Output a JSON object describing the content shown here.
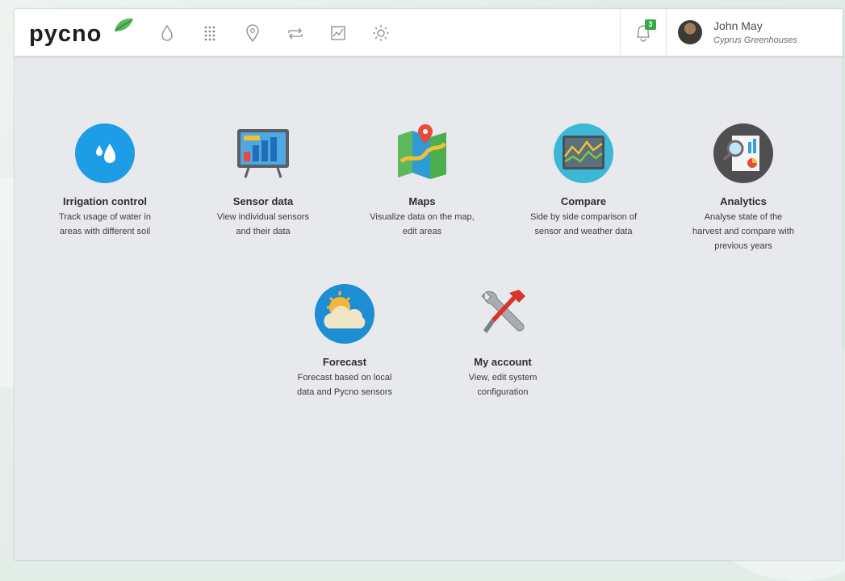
{
  "brand": {
    "logo_text": "pycno"
  },
  "nav": [
    {
      "name": "irrigation",
      "icon": "water-drop-icon"
    },
    {
      "name": "sensors",
      "icon": "grid-dots-icon"
    },
    {
      "name": "maps",
      "icon": "location-pin-icon"
    },
    {
      "name": "compare",
      "icon": "compare-arrows-icon"
    },
    {
      "name": "analytics",
      "icon": "line-chart-icon"
    },
    {
      "name": "forecast",
      "icon": "sun-icon"
    }
  ],
  "notifications": {
    "count": "3",
    "icon": "bell-icon"
  },
  "user": {
    "name": "John May",
    "organization": "Cyprus Greenhouses"
  },
  "tiles": [
    {
      "title": "Irrigation control",
      "desc_1": "Track usage of water in",
      "desc_2": "areas with different soil",
      "desc_3": "",
      "icon": "irrigation-drops-icon"
    },
    {
      "title": "Sensor data",
      "desc_1": "View individual sensors",
      "desc_2": "and their data",
      "desc_3": "",
      "icon": "sensor-monitor-icon"
    },
    {
      "title": "Maps",
      "desc_1": "Visualize data on the map,",
      "desc_2": "edit areas",
      "desc_3": "",
      "icon": "folded-map-icon"
    },
    {
      "title": "Compare",
      "desc_1": "Side by side comparison of",
      "desc_2": "sensor and weather data",
      "desc_3": "",
      "icon": "compare-chart-icon"
    },
    {
      "title": "Analytics",
      "desc_1": "Analyse state of the",
      "desc_2": "harvest and compare with",
      "desc_3": "previous years",
      "icon": "analytics-magnifier-icon"
    },
    {
      "title": "Forecast",
      "desc_1": "Forecast based on local",
      "desc_2": "data and Pycno sensors",
      "desc_3": "",
      "icon": "sun-cloud-icon"
    },
    {
      "title": "My account",
      "desc_1": "View, edit system",
      "desc_2": "configuration",
      "desc_3": "",
      "icon": "wrench-screwdriver-icon"
    }
  ],
  "colors": {
    "brand_green": "#3aa845",
    "irrigation_blue": "#1d9de6",
    "panel_bg": "#e8e9ec"
  }
}
